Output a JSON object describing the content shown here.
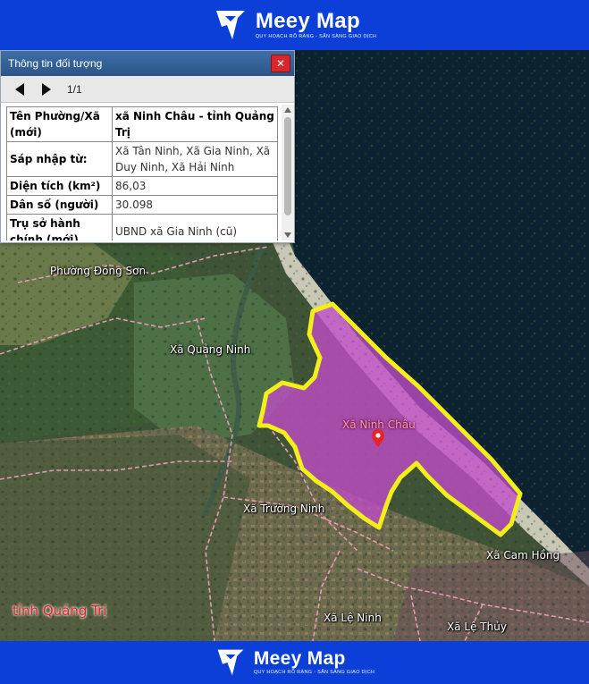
{
  "header": {
    "brand": "Meey Map",
    "tagline": "QUY HOẠCH RÕ RÀNG - SẴN SÀNG GIAO DỊCH"
  },
  "footer": {
    "brand": "Meey Map",
    "tagline": "QUY HOẠCH RÕ RÀNG - SẴN SÀNG GIAO DỊCH"
  },
  "panel": {
    "title": "Thông tin đối tượng",
    "close_label": "✕",
    "pager": {
      "count": "1/1"
    },
    "rows": [
      {
        "key": "Tên Phường/Xã (mới)",
        "value": "xã Ninh Châu - tỉnh Quảng Trị"
      },
      {
        "key": "Sáp nhập từ:",
        "value": "Xã Tân Ninh, Xã Gia Ninh, Xã Duy Ninh, Xã Hải Ninh"
      },
      {
        "key": "Diện tích (km²)",
        "value": "86,03"
      },
      {
        "key": "Dân số (người)",
        "value": "30.098"
      },
      {
        "key": "Trụ sở hành chính (mới)",
        "value": "UBND xã Gia Ninh (cũ)"
      }
    ]
  },
  "map": {
    "labels": {
      "dong_son": "Phường Đồng Sơn",
      "quang_ninh": "Xã Quảng Ninh",
      "ninh_chau": "Xã Ninh Châu",
      "truong_ninh": "Xã Trường Ninh",
      "cam_hong": "Xã Cam Hồng",
      "le_ninh": "Xã Lệ Ninh",
      "le_thuy": "Xã Lệ Thủy",
      "province": "tỉnh Quảng Trị"
    },
    "colors": {
      "selected_fill": "#c24bc9",
      "selected_border": "#f4ee1a",
      "boundary": "#e59ab4",
      "sea": "#0d2230",
      "brand_blue": "#0b3fd8"
    }
  }
}
